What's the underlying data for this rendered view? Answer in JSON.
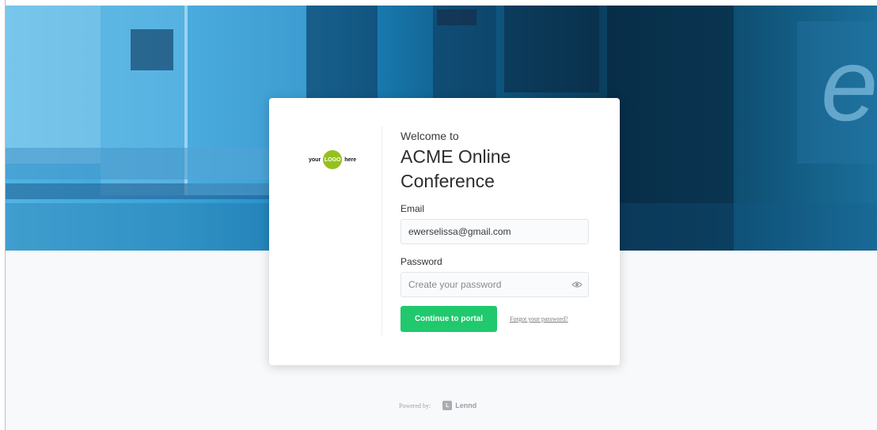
{
  "logo": {
    "prefix": "your",
    "center": "LOGO",
    "suffix": "here"
  },
  "login": {
    "welcome": "Welcome to",
    "event_title_line1": "ACME Online",
    "event_title_line2": "Conference",
    "email_label": "Email",
    "email_value": "ewerselissa@gmail.com",
    "password_label": "Password",
    "password_placeholder": "Create your password",
    "submit_label": "Continue to portal",
    "forgot_label": "Forgot your password?"
  },
  "footer": {
    "powered_by": "Powered by:",
    "brand_initial": "L",
    "brand_name": "Lennd"
  },
  "colors": {
    "accent_green": "#20c96e",
    "logo_green": "#95c11f",
    "hero_blue": "#1e86bf"
  },
  "icons": {
    "password_toggle": "eye-icon",
    "brand": "lennd-logo-icon"
  }
}
